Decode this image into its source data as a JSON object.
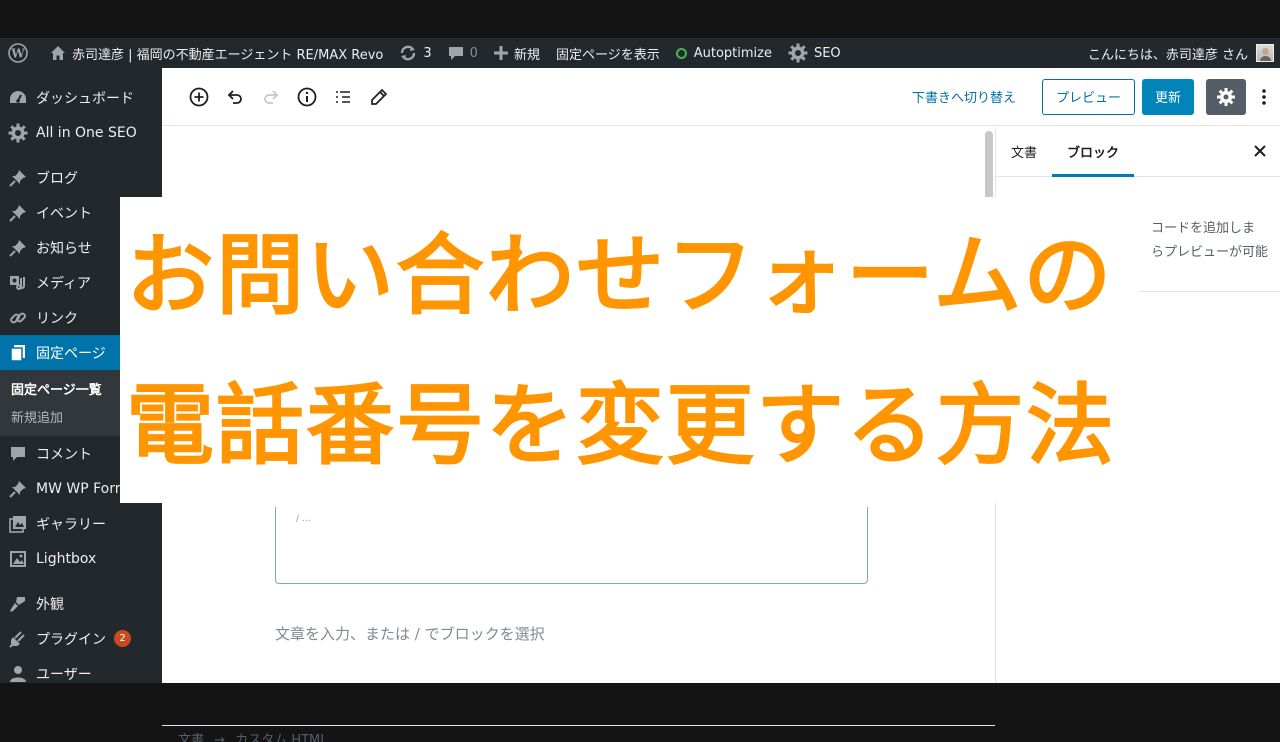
{
  "admin_bar": {
    "site_name": "赤司達彦 | 福岡の不動産エージェント RE/MAX Revo",
    "updates_count": "3",
    "comments_count": "0",
    "new_label": "新規",
    "view_page_label": "固定ページを表示",
    "autoptimize_label": "Autoptimize",
    "seo_label": "SEO",
    "greeting": "こんにちは、赤司達彦 さん"
  },
  "sidebar": {
    "items": [
      {
        "label": "ダッシュボード",
        "icon": "dashboard-icon"
      },
      {
        "label": "All in One SEO",
        "icon": "gear-icon"
      },
      {
        "label": "ブログ",
        "icon": "pin-icon"
      },
      {
        "label": "イベント",
        "icon": "pin-icon"
      },
      {
        "label": "お知らせ",
        "icon": "pin-icon"
      },
      {
        "label": "メディア",
        "icon": "media-icon"
      },
      {
        "label": "リンク",
        "icon": "link-icon"
      },
      {
        "label": "固定ページ",
        "icon": "pages-icon"
      },
      {
        "label": "コメント",
        "icon": "comment-icon"
      },
      {
        "label": "MW WP Form",
        "icon": "pin-icon"
      },
      {
        "label": "ギャラリー",
        "icon": "gallery-icon"
      },
      {
        "label": "Lightbox",
        "icon": "image-icon"
      },
      {
        "label": "外観",
        "icon": "brush-icon"
      },
      {
        "label": "プラグイン",
        "icon": "plugin-icon",
        "badge": "2"
      },
      {
        "label": "ユーザー",
        "icon": "user-icon"
      }
    ],
    "submenu": [
      {
        "label": "固定ページ一覧"
      },
      {
        "label": "新規追加"
      }
    ]
  },
  "editor": {
    "switch_to_draft": "下書きへ切り替え",
    "preview_label": "プレビュー",
    "update_label": "更新",
    "block_placeholder": "文章を入力、または / でブロックを選択",
    "code_snippet": "/ ...",
    "breadcrumb": [
      "文書",
      "→",
      "カスタム HTML"
    ]
  },
  "panel": {
    "tabs": [
      "文書",
      "ブロック"
    ],
    "active_tab": "ブロック",
    "description_lines": [
      "コードを追加しま",
      "らプレビューが可能"
    ]
  },
  "overlay": {
    "line1": "お問い合わせフォームの",
    "line2": "電話番号を変更する方法",
    "color": "#ff9500"
  }
}
